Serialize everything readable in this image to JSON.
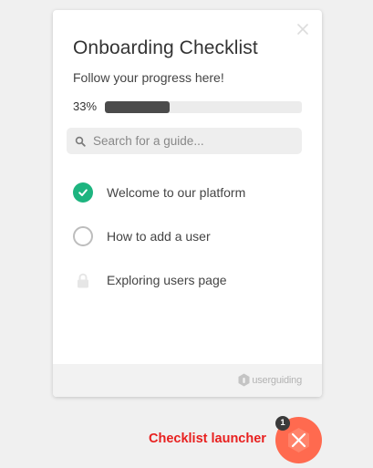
{
  "panel": {
    "title": "Onboarding Checklist",
    "subtitle": "Follow your progress here!",
    "progress": {
      "label": "33%",
      "fraction": 0.33
    },
    "search": {
      "placeholder": "Search for a guide..."
    },
    "items": [
      {
        "label": "Welcome to our platform",
        "status": "completed",
        "icon": "check-icon"
      },
      {
        "label": "How to add a user",
        "status": "pending",
        "icon": "empty-circle-icon"
      },
      {
        "label": "Exploring users page",
        "status": "locked",
        "icon": "lock-icon"
      }
    ],
    "footer": {
      "brand": "userguiding"
    }
  },
  "launcher": {
    "label": "Checklist launcher",
    "badge_count": "1"
  },
  "colors": {
    "progress_fill": "#4b4b4b",
    "check_green": "#1db47f",
    "launcher_orange": "#ff6a4f",
    "label_red": "#e8201f"
  }
}
